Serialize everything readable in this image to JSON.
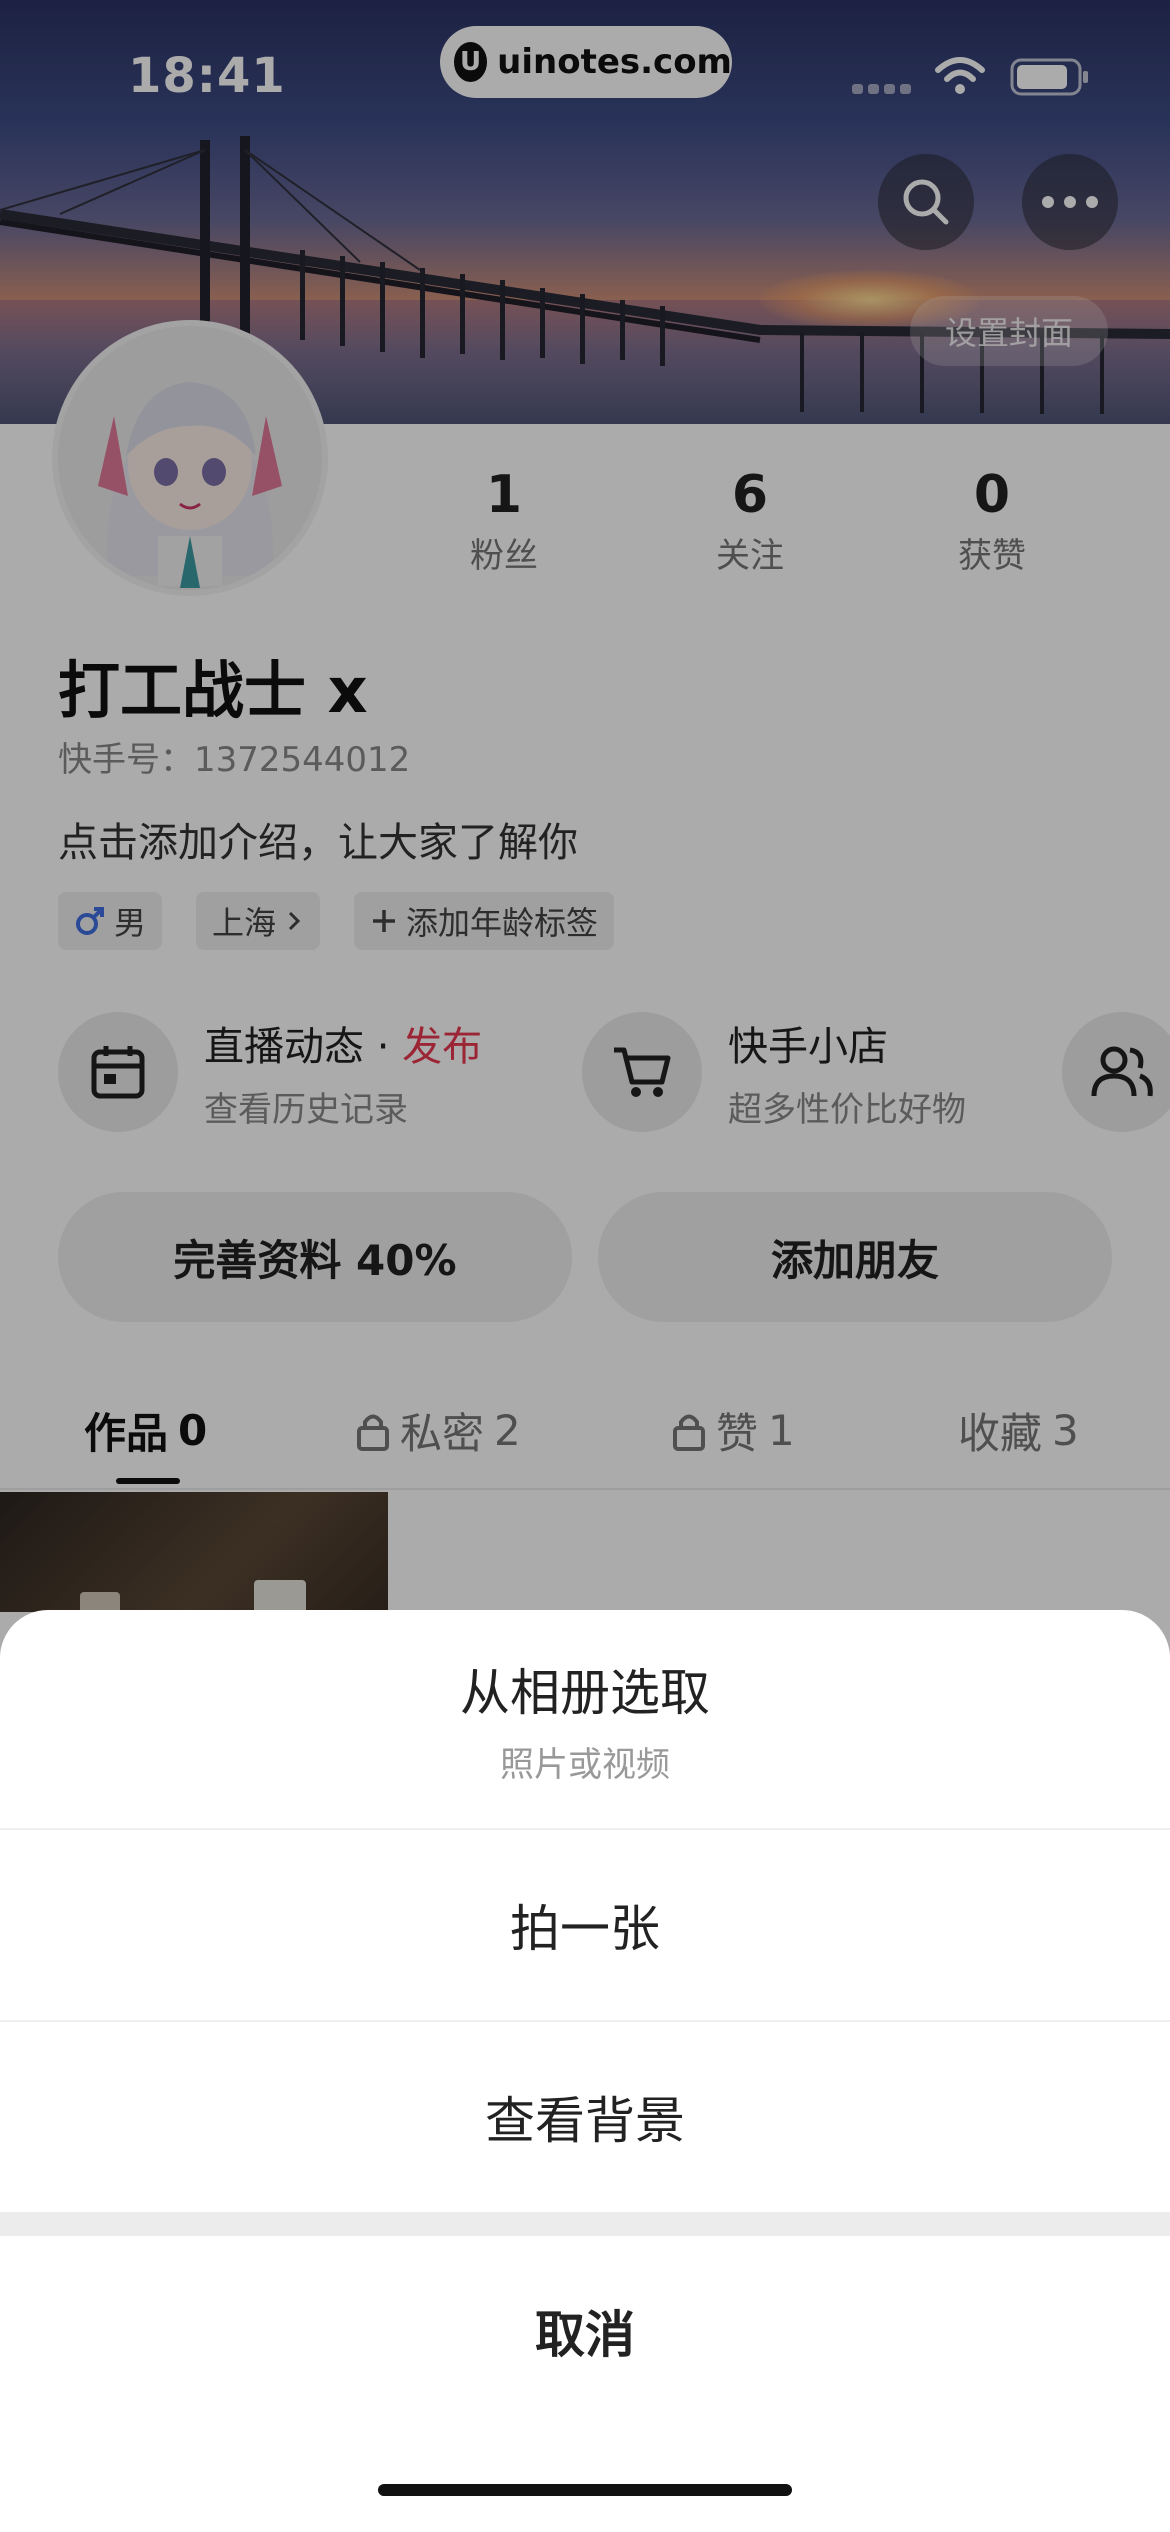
{
  "status_bar": {
    "time": "18:41",
    "url": "uinotes.com"
  },
  "cover": {
    "set_cover_label": "设置封面"
  },
  "profile": {
    "stats": [
      {
        "value": "1",
        "label": "粉丝"
      },
      {
        "value": "6",
        "label": "关注"
      },
      {
        "value": "0",
        "label": "获赞"
      }
    ],
    "name": "打工战士 x",
    "kuaishou_id": "快手号：1372544012",
    "bio": "点击添加介绍，让大家了解你",
    "chips": {
      "gender": "男",
      "city": "上海",
      "age_tag": "添加年龄标签"
    }
  },
  "features": {
    "live": {
      "title": "直播动态 · ",
      "highlight": "发布",
      "subtitle": "查看历史记录"
    },
    "shop": {
      "title": "快手小店",
      "subtitle": "超多性价比好物"
    }
  },
  "actions": {
    "complete_profile": "完善资料 40%",
    "add_friends": "添加朋友"
  },
  "tabs": [
    {
      "label": "作品",
      "count": "0"
    },
    {
      "label": "私密",
      "count": "2"
    },
    {
      "label": "赞",
      "count": "1"
    },
    {
      "label": "收藏",
      "count": "3"
    }
  ],
  "sheet": {
    "album": {
      "label": "从相册选取",
      "sublabel": "照片或视频"
    },
    "take_photo": "拍一张",
    "view_background": "查看背景",
    "cancel": "取消"
  },
  "colors": {
    "highlight": "#e8384f",
    "sheet_bg": "#ffffff",
    "overlay": "rgba(0,0,0,0.33)"
  }
}
